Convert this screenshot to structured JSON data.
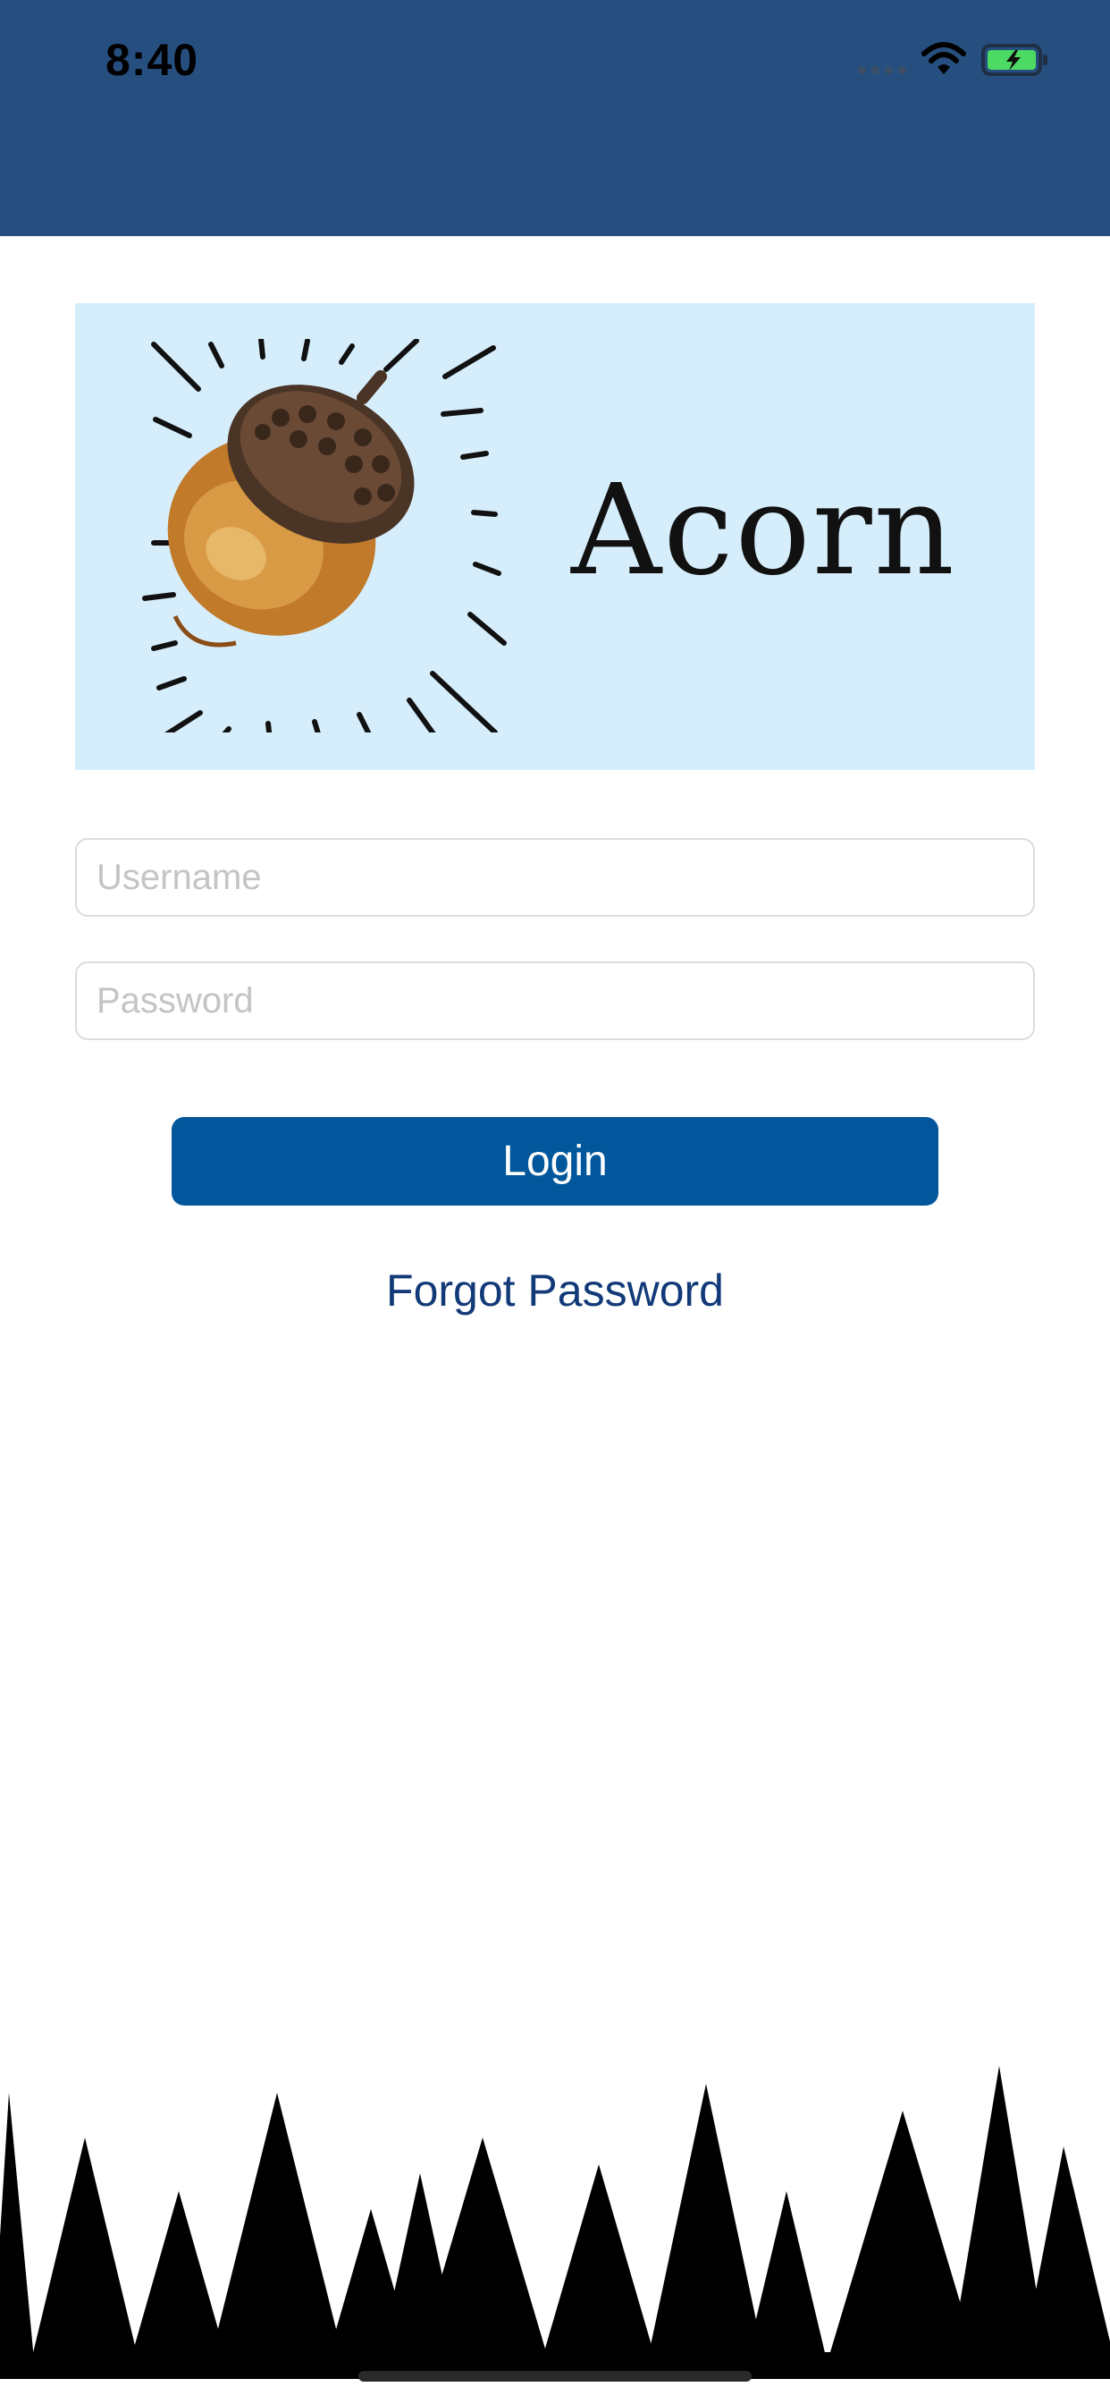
{
  "status_bar": {
    "time": "8:40",
    "icons": [
      "cellular-signal-icon",
      "wifi-icon",
      "battery-charging-icon"
    ]
  },
  "logo": {
    "text": "Acorn",
    "image": "acorn-illustration"
  },
  "form": {
    "username_placeholder": "Username",
    "username_value": "",
    "password_placeholder": "Password",
    "password_value": ""
  },
  "actions": {
    "login_label": "Login",
    "forgot_password_label": "Forgot Password"
  },
  "colors": {
    "header": "#264f80",
    "logo_background": "#d6eefc",
    "login_button": "#02579c",
    "link": "#123a78",
    "battery": "#4cd964"
  }
}
